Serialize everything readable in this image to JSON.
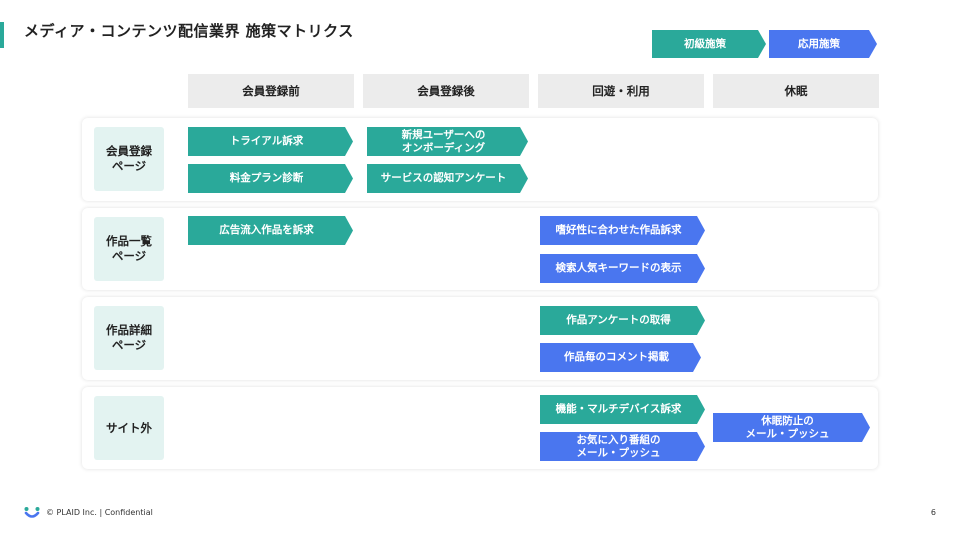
{
  "title": "メディア・コンテンツ配信業界 施策マトリクス",
  "legend": {
    "basic": "初級施策",
    "advanced": "応用施策"
  },
  "columns": [
    "会員登録前",
    "会員登録後",
    "回遊・利用",
    "休眠"
  ],
  "rows": [
    {
      "label_line1": "会員登録",
      "label_line2": "ページ"
    },
    {
      "label_line1": "作品一覧",
      "label_line2": "ページ"
    },
    {
      "label_line1": "作品詳細",
      "label_line2": "ページ"
    },
    {
      "label_line1": "サイト外",
      "label_line2": ""
    }
  ],
  "measures": {
    "trial_appeal": "トライアル訴求",
    "price_plan_diagnosis": "料金プラン診断",
    "new_user_onboarding_l1": "新規ユーザーへの",
    "new_user_onboarding_l2": "オンボーディング",
    "service_awareness_survey": "サービスの認知アンケート",
    "ad_inflow_appeal": "広告流入作品を訴求",
    "preference_matched_appeal": "嗜好性に合わせた作品訴求",
    "popular_search_keywords": "検索人気キーワードの表示",
    "work_survey": "作品アンケートの取得",
    "work_comments": "作品毎のコメント掲載",
    "multi_device_appeal": "機能・マルチデバイス訴求",
    "favorites_mail_l1": "お気に入り番組の",
    "favorites_mail_l2": "メール・プッシュ",
    "dormancy_mail_l1": "休眠防止の",
    "dormancy_mail_l2": "メール・プッシュ"
  },
  "colors": {
    "basic": "#2aa99a",
    "advanced": "#4a76ef"
  },
  "footer": {
    "copyright": "© PLAID Inc.  |  Confidential",
    "page_number": "6"
  }
}
